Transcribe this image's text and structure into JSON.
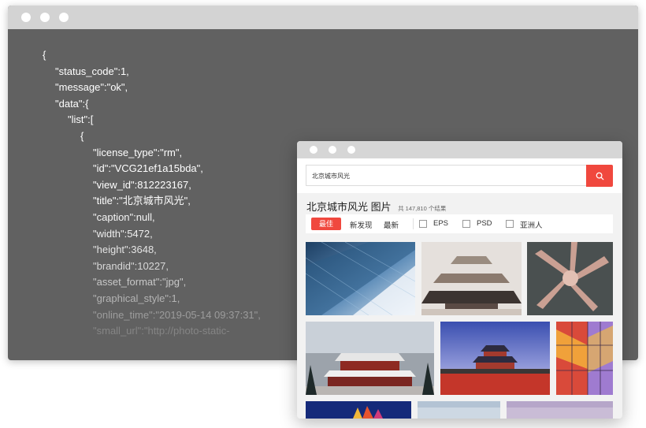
{
  "code_window": {
    "lines": [
      {
        "text": "{",
        "indent": 0,
        "shade": "#ffffff"
      },
      {
        "text": "\"status_code\":1,",
        "indent": 1,
        "shade": "#ffffff"
      },
      {
        "text": "\"message\":\"ok\",",
        "indent": 1,
        "shade": "#ffffff"
      },
      {
        "text": "\"data\":{",
        "indent": 1,
        "shade": "#ffffff"
      },
      {
        "text": "\"list\":[",
        "indent": 2,
        "shade": "#ffffff"
      },
      {
        "text": "{",
        "indent": 3,
        "shade": "#ffffff"
      },
      {
        "text": "\"license_type\":\"rm\",",
        "indent": 4,
        "shade": "#ffffff"
      },
      {
        "text": "\"id\":\"VCG21ef1a15bda\",",
        "indent": 4,
        "shade": "#ffffff"
      },
      {
        "text": "\"view_id\":812223167,",
        "indent": 4,
        "shade": "#ffffff"
      },
      {
        "text": "\"title\":\"北京城市风光\",",
        "indent": 4,
        "shade": "#ffffff"
      },
      {
        "text": "\"caption\":null,",
        "indent": 4,
        "shade": "#f4f4f4"
      },
      {
        "text": "\"width\":5472,",
        "indent": 4,
        "shade": "#eeeeee"
      },
      {
        "text": "\"height\":3648,",
        "indent": 4,
        "shade": "#e4e4e4"
      },
      {
        "text": "\"brandid\":10227,",
        "indent": 4,
        "shade": "#d8d8d8"
      },
      {
        "text": "\"asset_format\":\"jpg\",",
        "indent": 4,
        "shade": "#c8c8c8"
      },
      {
        "text": "\"graphical_style\":1,",
        "indent": 4,
        "shade": "#b4b4b4"
      },
      {
        "text": "\"online_time\":\"2019-05-14 09:37:31\",",
        "indent": 4,
        "shade": "#9c9c9c"
      },
      {
        "text": "\"small_url\":\"http://photo-static-",
        "indent": 4,
        "shade": "#858585"
      }
    ]
  },
  "gallery_window": {
    "search_query": "北京城市风光",
    "page_title": "北京城市风光 图片",
    "result_count": "共 147,810 个结果",
    "filters": {
      "best": "最佳",
      "new_discover": "新发现",
      "latest": "最新",
      "eps": "EPS",
      "psd": "PSD",
      "asian": "亚洲人"
    }
  },
  "colors": {
    "accent": "#f0483e",
    "code_background": "#616161",
    "titlebar": "#d3d3d3"
  },
  "icons": {
    "search_button": "search-icon"
  }
}
